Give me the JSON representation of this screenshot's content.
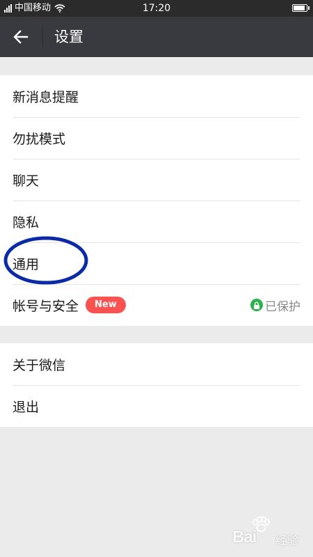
{
  "status_bar": {
    "carrier": "中国移动",
    "time": "17:20",
    "battery_level": 0.9
  },
  "header": {
    "title": "设置",
    "back_icon": "arrow-left-icon"
  },
  "groups": [
    {
      "items": [
        {
          "label": "新消息提醒"
        },
        {
          "label": "勿扰模式"
        },
        {
          "label": "聊天"
        },
        {
          "label": "隐私"
        },
        {
          "label": "通用"
        },
        {
          "label": "帐号与安全",
          "badge": "New",
          "status": "已保护"
        }
      ]
    },
    {
      "items": [
        {
          "label": "关于微信"
        },
        {
          "label": "退出"
        }
      ]
    }
  ],
  "watermark": {
    "brand": "Bai",
    "text": "经验"
  },
  "colors": {
    "header_bg": "#393a3f",
    "status_bar_bg": "#2b2b2b",
    "page_bg": "#ebebeb",
    "badge_bg": "#fa5151",
    "lock_green": "#2bb24c",
    "annotation_blue": "#0a2aa8"
  }
}
